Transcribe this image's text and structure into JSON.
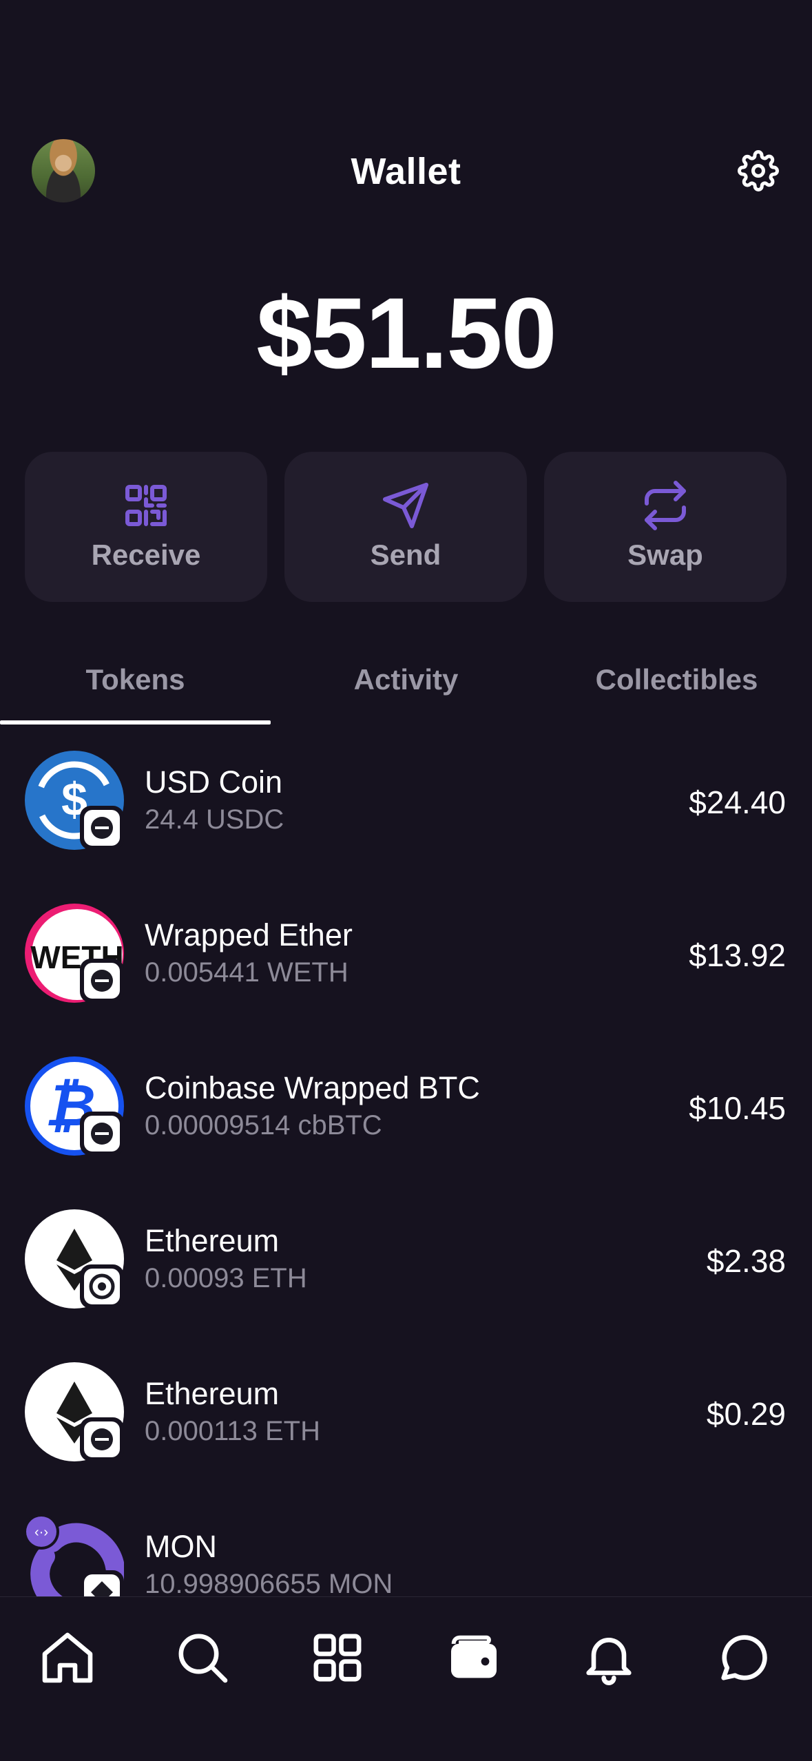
{
  "header": {
    "title": "Wallet",
    "avatar_icon": "user-avatar",
    "settings_icon": "gear-icon"
  },
  "balance": "$51.50",
  "actions": [
    {
      "label": "Receive",
      "icon": "qr-code-icon"
    },
    {
      "label": "Send",
      "icon": "paper-plane-icon"
    },
    {
      "label": "Swap",
      "icon": "swap-arrows-icon"
    }
  ],
  "tabs": [
    {
      "label": "Tokens",
      "active": true
    },
    {
      "label": "Activity",
      "active": false
    },
    {
      "label": "Collectibles",
      "active": false
    }
  ],
  "tokens": [
    {
      "name": "USD Coin",
      "amount": "24.4 USDC",
      "value": "$24.40",
      "icon": "usdc-icon"
    },
    {
      "name": "Wrapped Ether",
      "amount": "0.005441 WETH",
      "value": "$13.92",
      "icon": "weth-icon"
    },
    {
      "name": "Coinbase Wrapped BTC",
      "amount": "0.00009514 cbBTC",
      "value": "$10.45",
      "icon": "cbbtc-icon"
    },
    {
      "name": "Ethereum",
      "amount": "0.00093 ETH",
      "value": "$2.38",
      "icon": "ethereum-icon"
    },
    {
      "name": "Ethereum",
      "amount": "0.000113 ETH",
      "value": "$0.29",
      "icon": "ethereum-icon"
    },
    {
      "name": "MON",
      "amount": "10.998906655 MON",
      "value": "",
      "icon": "mon-icon"
    }
  ],
  "nav": [
    "home-icon",
    "search-icon",
    "apps-grid-icon",
    "wallet-icon",
    "bell-icon",
    "chat-icon"
  ],
  "colors": {
    "background": "#16121f",
    "card": "#221d2c",
    "accent": "#7b5ad6",
    "muted_text": "#8d8a98"
  }
}
